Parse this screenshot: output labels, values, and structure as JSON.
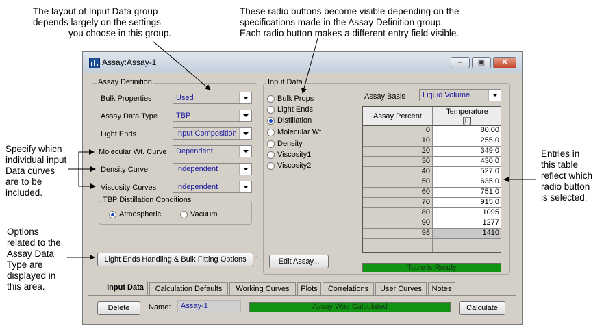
{
  "callouts": {
    "top_left": [
      "The layout of Input Data group",
      "depends largely on the settings",
      "you choose in this group."
    ],
    "top_right": [
      "These radio buttons become visible depending on the",
      "specifications made in the Assay Definition group.",
      "Each radio button makes a different entry field visible."
    ],
    "left_mid": [
      "Specify which",
      "individual input",
      "Data curves",
      "are to be",
      "included."
    ],
    "left_bottom": [
      "Options",
      "related to the",
      "Assay Data",
      "Type are",
      "displayed in",
      "this area."
    ],
    "right": [
      "Entries in",
      "this table",
      "reflect which",
      "radio button",
      "is selected."
    ]
  },
  "window": {
    "title": "Assay:Assay-1",
    "buttons": [
      "minimize",
      "maximize",
      "close"
    ]
  },
  "assay_definition": {
    "group_label": "Assay Definition",
    "fields": [
      {
        "label": "Bulk Properties",
        "value": "Used"
      },
      {
        "label": "Assay Data Type",
        "value": "TBP"
      },
      {
        "label": "Light Ends",
        "value": "Input Composition"
      },
      {
        "label": "Molecular Wt. Curve",
        "value": "Dependent"
      },
      {
        "label": "Density Curve",
        "value": "Independent"
      },
      {
        "label": "Viscosity Curves",
        "value": "Independent"
      }
    ],
    "tbp_group_label": "TBP Distillation Conditions",
    "tbp_options": [
      {
        "label": "Atmospheric",
        "selected": true
      },
      {
        "label": "Vacuum",
        "selected": false
      }
    ],
    "options_button": "Light Ends Handling & Bulk Fitting Options"
  },
  "input_data": {
    "group_label": "Input Data",
    "radios": [
      {
        "label": "Bulk Props",
        "selected": false
      },
      {
        "label": "Light Ends",
        "selected": false
      },
      {
        "label": "Distillation",
        "selected": true
      },
      {
        "label": "Molecular Wt",
        "selected": false
      },
      {
        "label": "Density",
        "selected": false
      },
      {
        "label": "Viscosity1",
        "selected": false
      },
      {
        "label": "Viscosity2",
        "selected": false
      }
    ],
    "assay_basis_label": "Assay Basis",
    "assay_basis_value": "Liquid Volume",
    "table": {
      "col1": "Assay Percent",
      "col2_line1": "Temperature",
      "col2_line2": "[F]",
      "rows": [
        [
          "0",
          "80.00"
        ],
        [
          "10",
          "255.0"
        ],
        [
          "20",
          "349.0"
        ],
        [
          "30",
          "430.0"
        ],
        [
          "40",
          "527.0"
        ],
        [
          "50",
          "635.0"
        ],
        [
          "60",
          "751.0"
        ],
        [
          "70",
          "915.0"
        ],
        [
          "80",
          "1095"
        ],
        [
          "90",
          "1277"
        ],
        [
          "98",
          "1410"
        ]
      ]
    },
    "edit_button": "Edit Assay...",
    "table_status": "Table is Ready"
  },
  "tabs": [
    {
      "label": "Input Data",
      "active": true
    },
    {
      "label": "Calculation Defaults",
      "active": false
    },
    {
      "label": "Working Curves",
      "active": false
    },
    {
      "label": "Plots",
      "active": false
    },
    {
      "label": "Correlations",
      "active": false
    },
    {
      "label": "User Curves",
      "active": false
    },
    {
      "label": "Notes",
      "active": false
    }
  ],
  "footer": {
    "delete_button": "Delete",
    "name_label": "Name:",
    "name_value": "Assay-1",
    "status": "Assay Was Calculated",
    "calculate_button": "Calculate"
  },
  "colors": {
    "status_green": "#119411",
    "value_blue": "#1a1aa0",
    "radio_selected": "#1e3fbf"
  }
}
